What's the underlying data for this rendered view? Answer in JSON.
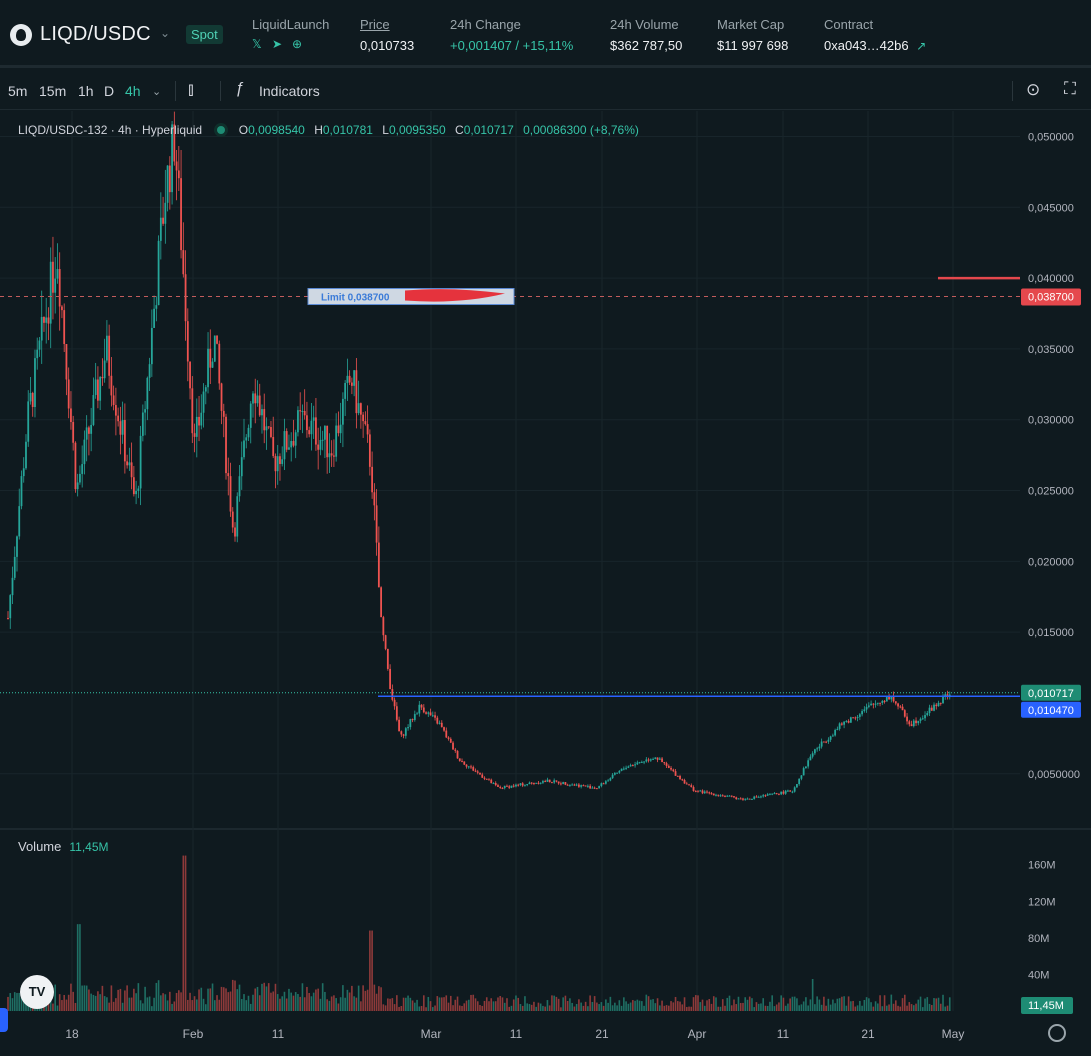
{
  "header": {
    "pair": "LIQD/USDC",
    "market_type": "Spot",
    "launch": {
      "label": "LiquidLaunch",
      "icons": [
        "x-icon",
        "telegram-icon",
        "globe-icon"
      ]
    },
    "price": {
      "label": "Price",
      "value": "0,010733"
    },
    "change": {
      "label": "24h Change",
      "value": "+0,001407 / +15,11%"
    },
    "volume": {
      "label": "24h Volume",
      "value": "$362 787,50"
    },
    "mcap": {
      "label": "Market Cap",
      "value": "$11 997 698"
    },
    "contract": {
      "label": "Contract",
      "value": "0xa043…42b6"
    }
  },
  "toolbar": {
    "timeframes": [
      "5m",
      "15m",
      "1h",
      "D",
      "4h"
    ],
    "active_timeframe": "4h",
    "indicators_label": "Indicators"
  },
  "legend": {
    "symbol": "LIQD/USDC-132 · 4h · Hyperliquid",
    "o_label": "O",
    "o": "0,0098540",
    "h_label": "H",
    "h": "0,010781",
    "l_label": "L",
    "l": "0,0095350",
    "c_label": "C",
    "c": "0,010717",
    "change": "0,00086300 (+8,76%)"
  },
  "volume_pane": {
    "label": "Volume",
    "value": "11,45M",
    "badge": "11,45M"
  },
  "order_label": "Limit 0,038700",
  "colors": {
    "up": "#26a69a",
    "down": "#ef5350",
    "accent": "#2962ff",
    "order": "#ef5350",
    "bg": "#0f1a1f"
  },
  "chart_data": {
    "type": "candlestick",
    "title": "LIQD/USDC-132 · 4h · Hyperliquid",
    "y_axis_ticks": [
      "0,050000",
      "0,045000",
      "0,040000",
      "0,035000",
      "0,030000",
      "0,025000",
      "0,020000",
      "0,015000",
      "0,0050000"
    ],
    "y_tick_values": [
      0.05,
      0.045,
      0.04,
      0.035,
      0.03,
      0.025,
      0.02,
      0.015,
      0.005
    ],
    "ylim": [
      0.0011,
      0.0518
    ],
    "x_axis_ticks": [
      "18",
      "Feb",
      "11",
      "Mar",
      "11",
      "21",
      "Apr",
      "11",
      "21",
      "May"
    ],
    "price_labels": {
      "current": "0,010717",
      "bid": "0,010470",
      "order": "0,038700"
    },
    "red_line_level": 0.04,
    "order_level": 0.0387,
    "current_level": 0.010717,
    "bid_level": 0.01047,
    "price_path": [
      [
        0,
        0.016
      ],
      [
        0.02,
        0.03
      ],
      [
        0.05,
        0.042
      ],
      [
        0.07,
        0.025
      ],
      [
        0.1,
        0.035
      ],
      [
        0.13,
        0.024
      ],
      [
        0.16,
        0.046
      ],
      [
        0.17,
        0.05
      ],
      [
        0.19,
        0.028
      ],
      [
        0.21,
        0.036
      ],
      [
        0.23,
        0.022
      ],
      [
        0.25,
        0.033
      ],
      [
        0.27,
        0.027
      ],
      [
        0.3,
        0.03
      ],
      [
        0.33,
        0.028
      ],
      [
        0.35,
        0.033
      ],
      [
        0.37,
        0.027
      ],
      [
        0.38,
        0.016
      ],
      [
        0.39,
        0.011
      ],
      [
        0.4,
        0.0075
      ],
      [
        0.42,
        0.0098
      ],
      [
        0.44,
        0.0085
      ],
      [
        0.46,
        0.006
      ],
      [
        0.5,
        0.004
      ],
      [
        0.55,
        0.0045
      ],
      [
        0.6,
        0.004
      ],
      [
        0.63,
        0.0055
      ],
      [
        0.66,
        0.0062
      ],
      [
        0.7,
        0.0038
      ],
      [
        0.75,
        0.0032
      ],
      [
        0.8,
        0.0038
      ],
      [
        0.82,
        0.0065
      ],
      [
        0.85,
        0.0085
      ],
      [
        0.88,
        0.0098
      ],
      [
        0.9,
        0.0105
      ],
      [
        0.92,
        0.0085
      ],
      [
        0.94,
        0.0095
      ],
      [
        0.96,
        0.0107
      ]
    ],
    "volume_ticks": [
      "160M",
      "120M",
      "80M",
      "40M"
    ],
    "volume_tick_values": [
      160,
      120,
      80,
      40
    ],
    "volume_max": 175,
    "volume_spikes": [
      [
        0.072,
        95
      ],
      [
        0.18,
        170
      ],
      [
        0.37,
        88
      ],
      [
        0.82,
        35
      ]
    ]
  }
}
